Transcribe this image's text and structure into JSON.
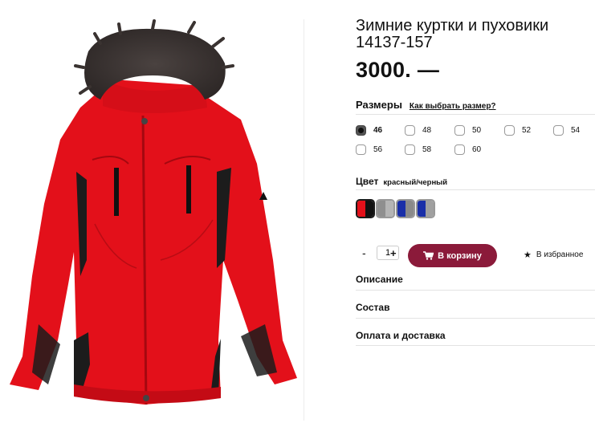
{
  "product": {
    "title": "Зимние куртки и пуховики 14137-157",
    "price": "3000. —",
    "image_alt": "red-black winter parka with fur hood"
  },
  "sizes": {
    "label": "Размеры",
    "guide_link": "Как выбрать размер?",
    "selected": "46",
    "options": [
      "46",
      "48",
      "50",
      "52",
      "54",
      "56",
      "58",
      "60"
    ]
  },
  "color": {
    "label": "Цвет",
    "value": "красный/черный",
    "swatches": [
      {
        "name": "red-black",
        "colors": [
          "#e3101a",
          "#111111"
        ],
        "selected": true
      },
      {
        "name": "gray",
        "colors": [
          "#9a9a9a",
          "#b0b0b0"
        ],
        "selected": false
      },
      {
        "name": "blue-gray",
        "colors": [
          "#1a2fa8",
          "#8a8a8a"
        ],
        "selected": false
      },
      {
        "name": "blue-gray-2",
        "colors": [
          "#1a2fa8",
          "#a0a0a0"
        ],
        "selected": false
      }
    ]
  },
  "purchase": {
    "minus": "-",
    "quantity": "1",
    "plus": "+",
    "cart_label": "В корзину",
    "favorite_label": "В избранное"
  },
  "accordion": {
    "description": "Описание",
    "composition": "Состав",
    "payment": "Оплата и доставка"
  },
  "colors": {
    "accent": "#8b1a3a",
    "jacket_red": "#e3101a"
  }
}
